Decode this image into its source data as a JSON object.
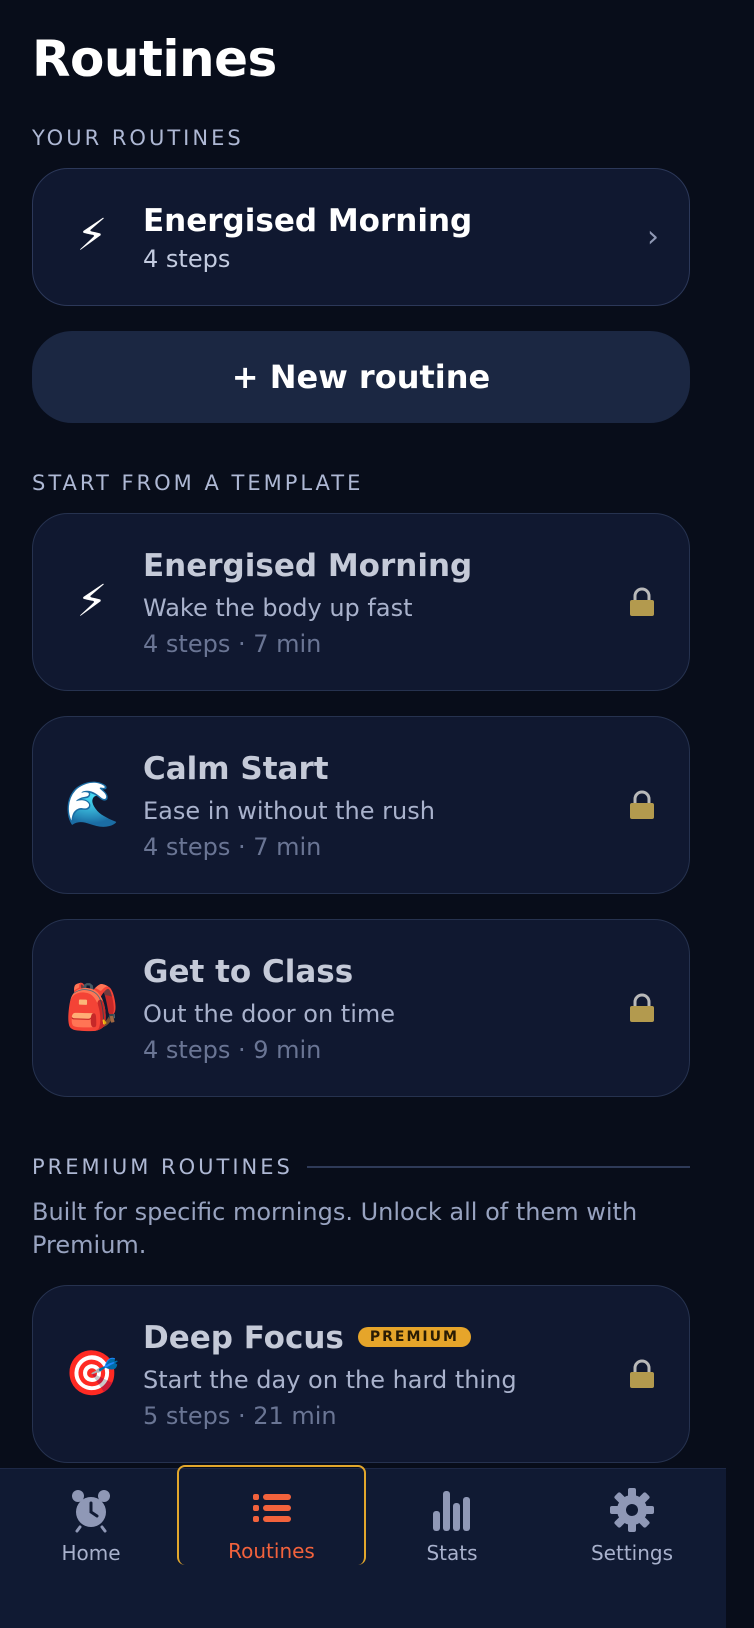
{
  "header": {
    "title": "Routines"
  },
  "your_routines": {
    "label": "YOUR ROUTINES",
    "items": [
      {
        "emoji": "⚡",
        "title": "Energised Morning",
        "subtitle": "4 steps",
        "chevron": "›"
      }
    ],
    "new_button": "+ New routine"
  },
  "templates": {
    "label": "START FROM A TEMPLATE",
    "items": [
      {
        "emoji": "⚡",
        "title": "Energised Morning",
        "subtitle": "Wake the body up fast",
        "meta": "4 steps · 7 min",
        "icon": "lock-icon"
      },
      {
        "emoji": "🌊",
        "title": "Calm Start",
        "subtitle": "Ease in without the rush",
        "meta": "4 steps · 7 min",
        "icon": "lock-icon"
      },
      {
        "emoji": "🎒",
        "title": "Get to Class",
        "subtitle": "Out the door on time",
        "meta": "4 steps · 9 min",
        "icon": "lock-icon"
      }
    ]
  },
  "premium": {
    "label": "PREMIUM ROUTINES",
    "description": "Built for specific mornings. Unlock all of them with Premium.",
    "items": [
      {
        "emoji": "🎯",
        "title": "Deep Focus",
        "badge": "PREMIUM",
        "subtitle": "Start the day on the hard thing",
        "meta": "5 steps · 21 min",
        "icon": "lock-icon"
      }
    ]
  },
  "tabs": [
    {
      "label": "Home",
      "icon": "alarm-clock-icon"
    },
    {
      "label": "Routines",
      "icon": "list-icon",
      "active": true
    },
    {
      "label": "Stats",
      "icon": "bar-chart-icon"
    },
    {
      "label": "Settings",
      "icon": "gear-icon"
    }
  ],
  "colors": {
    "background": "#080d1a",
    "card": "#101830",
    "accent": "#f2623c",
    "premium_badge": "#e6a52a",
    "active_tab_outline": "#e2a72c"
  }
}
